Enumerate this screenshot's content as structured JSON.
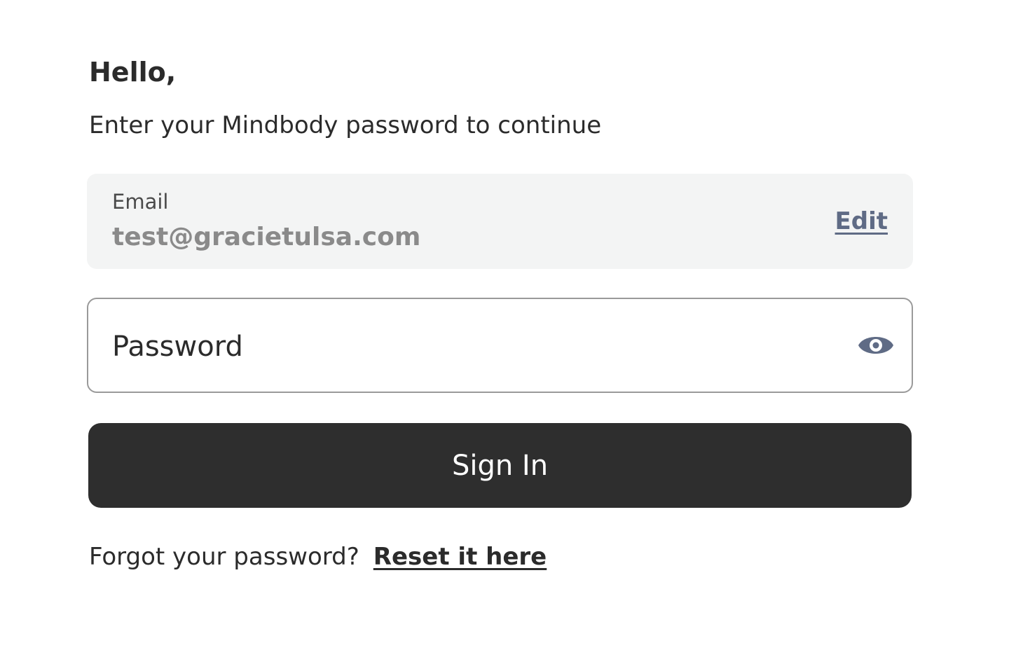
{
  "header": {
    "greeting": "Hello,",
    "subtitle": "Enter your Mindbody password to continue"
  },
  "email": {
    "label": "Email",
    "value": "test@gracietulsa.com",
    "edit_label": "Edit"
  },
  "password": {
    "placeholder": "Password",
    "value": "",
    "toggle_icon": "eye-icon"
  },
  "sign_in": {
    "label": "Sign In"
  },
  "forgot": {
    "prompt": "Forgot your password?",
    "link_label": "Reset it here"
  },
  "colors": {
    "button_bg": "#2e2e2e",
    "accent": "#5f6b85",
    "email_box_bg": "#f3f4f4"
  }
}
